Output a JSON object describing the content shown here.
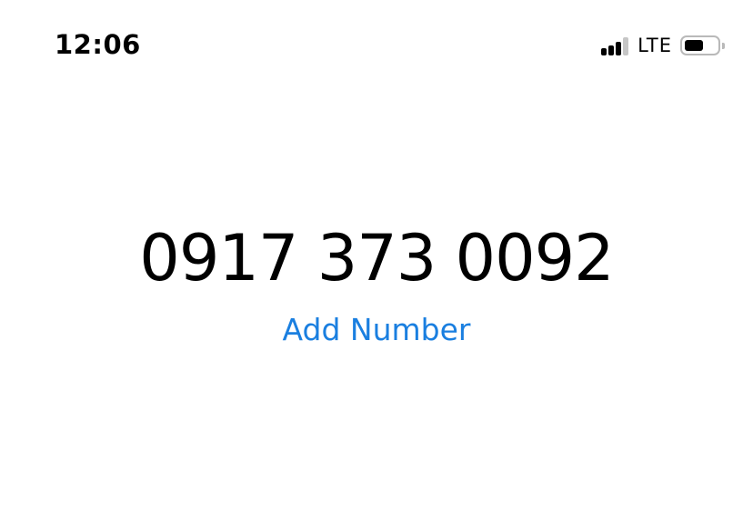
{
  "status_bar": {
    "time": "12:06",
    "network_type": "LTE",
    "signal": {
      "bars_total": 4,
      "bars_active": 3
    },
    "battery_level": 0.6
  },
  "dialer": {
    "number": "0917 373 0092",
    "add_number_label": "Add Number"
  },
  "colors": {
    "text": "#000000",
    "accent": "#1a7fe0",
    "inactive": "#c6c6c6"
  }
}
